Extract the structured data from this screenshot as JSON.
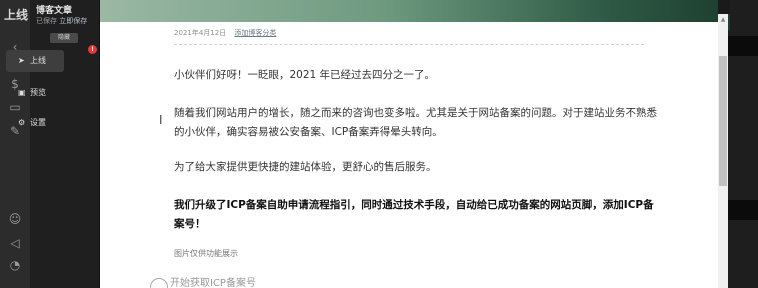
{
  "background_app": {
    "top_label": "上线"
  },
  "editor_panel": {
    "title": "博客文章",
    "status": "已保存",
    "save_now": "立即保存",
    "pill": "隐藏",
    "badge": "!",
    "menu": [
      {
        "label": "上线",
        "icon": "send-icon"
      },
      {
        "label": "预览",
        "icon": "preview-icon"
      },
      {
        "label": "设置",
        "icon": "gear-icon"
      }
    ]
  },
  "document": {
    "date": "2021年4月12日",
    "category": "添加博客分类",
    "p1": "小伙伴们好呀！一眨眼，2021 年已经过去四分之一了。",
    "p2": "随着我们网站用户的增长，随之而来的咨询也变多啦。尤其是关于网站备案的问题。对于建站业务不熟悉的小伙伴，确实容易被公安备案、ICP备案弄得晕头转向。",
    "p3": "为了给大家提供更快捷的建站体验，更舒心的售后服务。",
    "p4": "我们升级了ICP备案自助申请流程指引，同时通过技术手段，自动给已成功备案的网站页脚，添加ICP备案号！",
    "caption": "图片仅供功能展示",
    "next": "开始获取ICP备案号"
  }
}
